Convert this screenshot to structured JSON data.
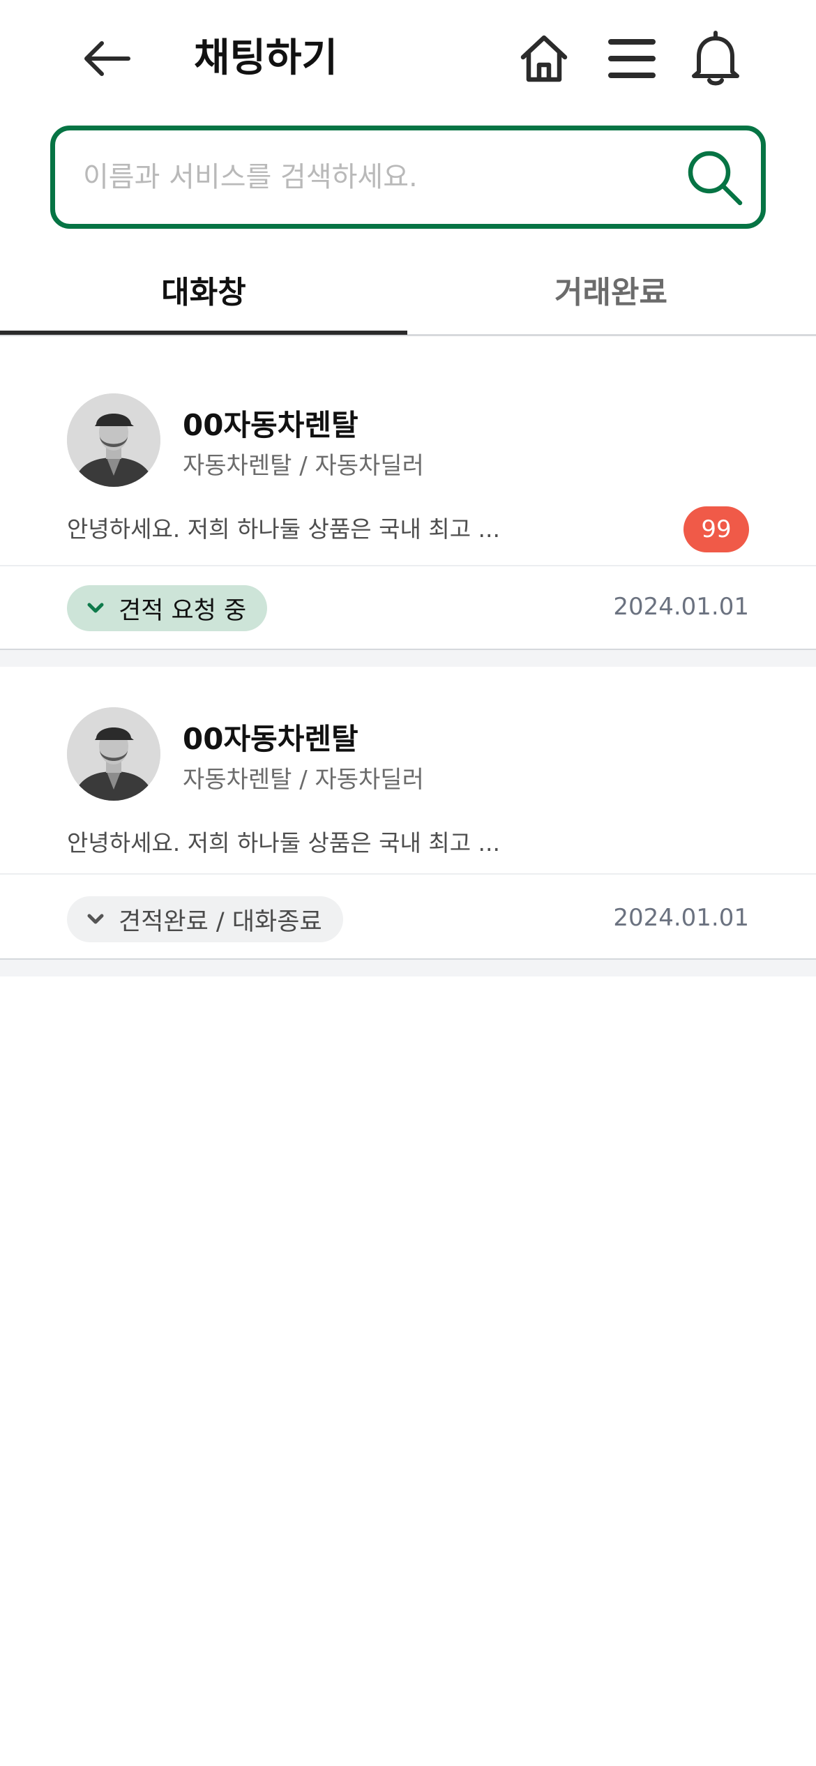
{
  "header": {
    "title": "채팅하기",
    "back_icon": "arrow-left-icon",
    "home_icon": "home-icon",
    "menu_icon": "menu-icon",
    "bell_icon": "bell-icon"
  },
  "search": {
    "placeholder": "이름과 서비스를 검색하세요.",
    "value": "",
    "icon": "search-icon",
    "accent_color": "#067444"
  },
  "tabs": [
    {
      "label": "대화창",
      "active": true
    },
    {
      "label": "거래완료",
      "active": false
    }
  ],
  "chats": [
    {
      "company": "00자동차렌탈",
      "category": "자동차렌탈 / 자동차딜러",
      "message": "안녕하세요. 저희 하나둘 상품은 국내 최고 ...",
      "unread": "99",
      "status": "견적 요청 중",
      "date": "2024.01.01"
    },
    {
      "company": "00자동차렌탈",
      "category": "자동차렌탈 / 자동차딜러",
      "message": "안녕하세요. 저희 하나둘 상품은 국내 최고 ...",
      "unread": "",
      "status": "견적완료 / 대화종료",
      "date": "2024.01.01"
    }
  ],
  "colors": {
    "unread_badge": "#f05a48",
    "status_active_bg": "#cde4d8",
    "status_active_chevron": "#0e7a4b",
    "status_done_bg": "#f0f1f2"
  }
}
